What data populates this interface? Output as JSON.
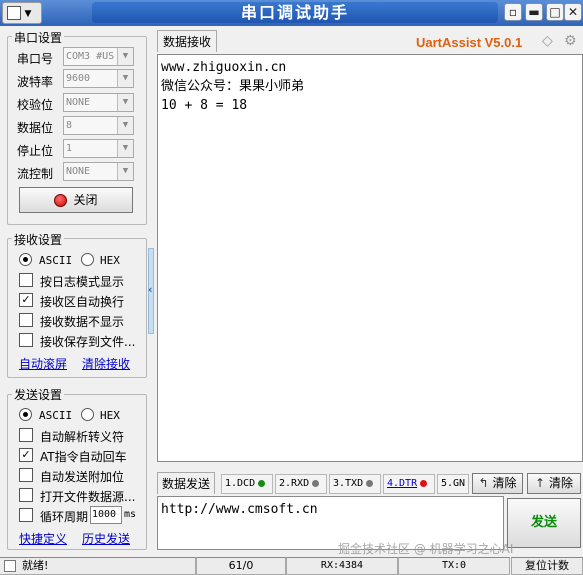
{
  "window": {
    "title": "串口调试助手",
    "sysmenu": "▼"
  },
  "brand": {
    "name": "UartAssist V5.0.1"
  },
  "serial_settings": {
    "title": "串口设置",
    "rows": [
      {
        "label": "串口号",
        "value": "COM3 #US"
      },
      {
        "label": "波特率",
        "value": "9600"
      },
      {
        "label": "校验位",
        "value": "NONE"
      },
      {
        "label": "数据位",
        "value": "8"
      },
      {
        "label": "停止位",
        "value": "1"
      },
      {
        "label": "流控制",
        "value": "NONE"
      }
    ],
    "close_button": "关闭"
  },
  "receive_settings": {
    "title": "接收设置",
    "ascii": "ASCII",
    "hex": "HEX",
    "mode": "ASCII",
    "options": [
      {
        "label": "按日志模式显示",
        "checked": false
      },
      {
        "label": "接收区自动换行",
        "checked": true
      },
      {
        "label": "接收数据不显示",
        "checked": false
      },
      {
        "label": "接收保存到文件...",
        "checked": false
      }
    ],
    "link_autoscroll": "自动滚屏",
    "link_clear": "清除接收"
  },
  "send_settings": {
    "title": "发送设置",
    "ascii": "ASCII",
    "hex": "HEX",
    "mode": "ASCII",
    "options": [
      {
        "label": "自动解析转义符",
        "checked": false
      },
      {
        "label": "AT指令自动回车",
        "checked": true
      },
      {
        "label": "自动发送附加位",
        "checked": false
      },
      {
        "label": "打开文件数据源...",
        "checked": false
      },
      {
        "label": "循环周期",
        "checked": false
      }
    ],
    "period_value": "1000",
    "period_unit": "ms",
    "link_shortcut": "快捷定义",
    "link_history": "历史发送"
  },
  "receive_area": {
    "tab": "数据接收",
    "text": "www.zhiguoxin.cn\n微信公众号：果果小师弟\n10 + 8 = 18"
  },
  "send_area": {
    "tab": "数据发送",
    "signals": [
      {
        "label": "1.DCD",
        "color": "#1a8a1a"
      },
      {
        "label": "2.RXD",
        "color": "#777777"
      },
      {
        "label": "3.TXD",
        "color": "#777777"
      },
      {
        "label": "4.DTR",
        "color": "#e01010"
      },
      {
        "label": "5.GN",
        "color": "#777777"
      }
    ],
    "clear1": "清除",
    "clear2": "清除",
    "text": "http://www.cmsoft.cn",
    "send_button": "发送"
  },
  "status": {
    "ready": "就绪!",
    "count": "61/0",
    "rx": "RX:4384",
    "tx": "TX:0",
    "reset": "复位计数"
  },
  "watermark": "掘金技术社区 @ 机器学习之心AI"
}
